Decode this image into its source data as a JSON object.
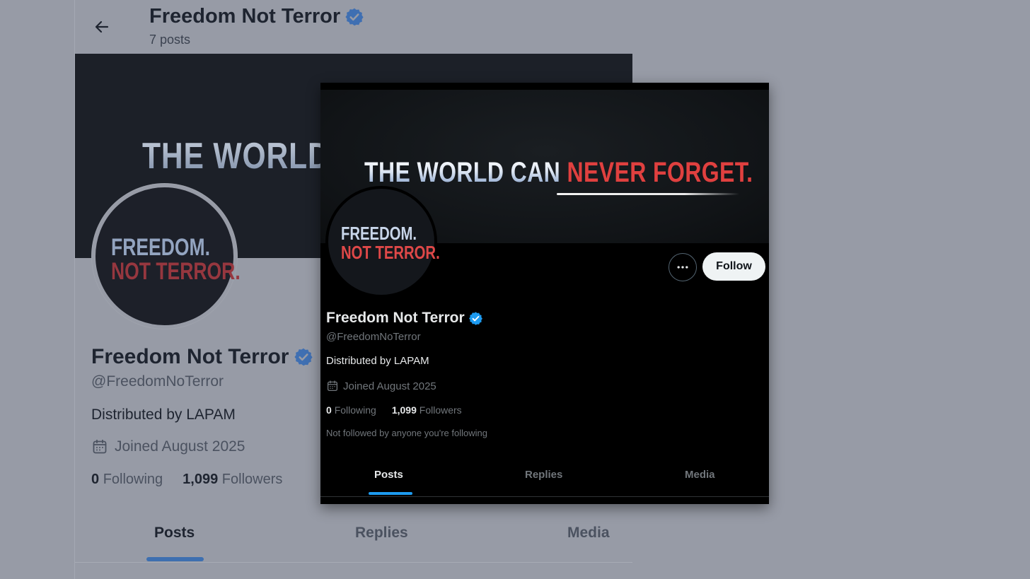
{
  "background_profile": {
    "header": {
      "title": "Freedom Not Terror",
      "post_count": "7 posts"
    },
    "banner_text": "THE WORLD",
    "avatar": {
      "line1": "FREEDOM.",
      "line2": "NOT TERROR."
    },
    "profile": {
      "name": "Freedom Not Terror",
      "handle": "@FreedomNoTerror",
      "bio": "Distributed by LAPAM",
      "joined": "Joined August 2025",
      "following_count": "0",
      "following_label": "Following",
      "followers_count": "1,099",
      "followers_label": "Followers"
    },
    "tabs": [
      {
        "label": "Posts"
      },
      {
        "label": "Replies"
      },
      {
        "label": "Media"
      }
    ]
  },
  "card_profile": {
    "banner": {
      "text_part1": "THE WORLD CAN ",
      "text_part2": "NEVER FORGET."
    },
    "avatar": {
      "line1": "FREEDOM.",
      "line2": "NOT TERROR."
    },
    "more_button_label": "···",
    "follow_label": "Follow",
    "profile": {
      "name": "Freedom Not Terror",
      "handle": "@FreedomNoTerror",
      "bio": "Distributed by LAPAM",
      "joined": "Joined August 2025",
      "following_count": "0",
      "following_label": "Following",
      "followers_count": "1,099",
      "followers_label": "Followers",
      "not_followed_note": "Not followed by anyone you're following"
    },
    "tabs": [
      {
        "label": "Posts"
      },
      {
        "label": "Replies"
      },
      {
        "label": "Media"
      }
    ]
  },
  "colors": {
    "verified_badge": "#1d9bf0",
    "tab_indicator": "#1d9bf0",
    "banner_red": "#e0403f"
  },
  "icons": {
    "back": "arrow-left-icon",
    "verified": "verified-badge-icon",
    "calendar": "calendar-icon",
    "more": "more-horizontal-icon"
  }
}
